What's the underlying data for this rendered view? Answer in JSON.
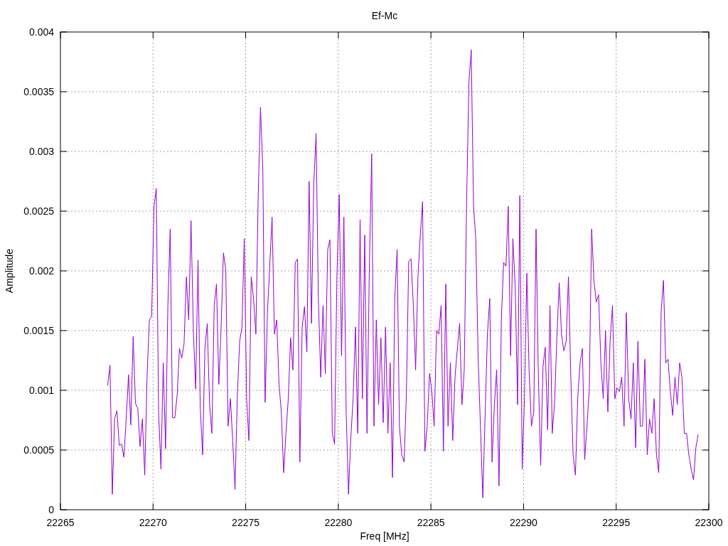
{
  "chart_data": {
    "type": "line",
    "grid": true,
    "title": "Ef-Mc",
    "xlabel": "Freq [MHz]",
    "ylabel": "Amplitude",
    "xlim": [
      22265,
      22300
    ],
    "ylim": [
      0,
      0.004
    ],
    "xticks": [
      22265,
      22270,
      22275,
      22280,
      22285,
      22290,
      22295,
      22300
    ],
    "yticks": [
      {
        "value": 0,
        "label": "0"
      },
      {
        "value": 0.0005,
        "label": "0.0005"
      },
      {
        "value": 0.001,
        "label": "0.001"
      },
      {
        "value": 0.0015,
        "label": "0.0015"
      },
      {
        "value": 0.002,
        "label": "0.002"
      },
      {
        "value": 0.0025,
        "label": "0.0025"
      },
      {
        "value": 0.003,
        "label": "0.003"
      },
      {
        "value": 0.0035,
        "label": "0.0035"
      },
      {
        "value": 0.004,
        "label": "0.004"
      }
    ],
    "x": [
      22267.55,
      22267.675,
      22267.8,
      22267.925,
      22268.05,
      22268.175,
      22268.3,
      22268.425,
      22268.55,
      22268.675,
      22268.8,
      22268.925,
      22269.05,
      22269.175,
      22269.3,
      22269.425,
      22269.55,
      22269.675,
      22269.8,
      22269.925,
      22270.05,
      22270.175,
      22270.3,
      22270.425,
      22270.55,
      22270.675,
      22270.8,
      22270.925,
      22271.05,
      22271.175,
      22271.3,
      22271.425,
      22271.55,
      22271.675,
      22271.8,
      22271.925,
      22272.05,
      22272.175,
      22272.3,
      22272.425,
      22272.55,
      22272.675,
      22272.8,
      22272.925,
      22273.05,
      22273.175,
      22273.3,
      22273.425,
      22273.55,
      22273.675,
      22273.8,
      22273.925,
      22274.05,
      22274.175,
      22274.3,
      22274.425,
      22274.55,
      22274.675,
      22274.8,
      22274.925,
      22275.05,
      22275.175,
      22275.3,
      22275.425,
      22275.55,
      22275.675,
      22275.8,
      22275.925,
      22276.05,
      22276.175,
      22276.3,
      22276.425,
      22276.55,
      22276.675,
      22276.8,
      22276.925,
      22277.05,
      22277.175,
      22277.3,
      22277.425,
      22277.55,
      22277.675,
      22277.8,
      22277.925,
      22278.05,
      22278.175,
      22278.3,
      22278.425,
      22278.55,
      22278.675,
      22278.8,
      22278.925,
      22279.05,
      22279.175,
      22279.3,
      22279.425,
      22279.55,
      22279.675,
      22279.8,
      22279.925,
      22280.05,
      22280.175,
      22280.3,
      22280.425,
      22280.55,
      22280.675,
      22280.8,
      22280.925,
      22281.05,
      22281.175,
      22281.3,
      22281.425,
      22281.55,
      22281.675,
      22281.8,
      22281.925,
      22282.05,
      22282.175,
      22282.3,
      22282.425,
      22282.55,
      22282.675,
      22282.8,
      22282.925,
      22283.05,
      22283.175,
      22283.3,
      22283.425,
      22283.55,
      22283.675,
      22283.8,
      22283.925,
      22284.05,
      22284.175,
      22284.3,
      22284.425,
      22284.55,
      22284.675,
      22284.8,
      22284.925,
      22285.05,
      22285.175,
      22285.3,
      22285.425,
      22285.55,
      22285.675,
      22285.8,
      22285.925,
      22286.05,
      22286.175,
      22286.3,
      22286.425,
      22286.55,
      22286.675,
      22286.8,
      22286.925,
      22287.05,
      22287.175,
      22287.3,
      22287.425,
      22287.55,
      22287.675,
      22287.8,
      22287.925,
      22288.05,
      22288.175,
      22288.3,
      22288.425,
      22288.55,
      22288.675,
      22288.8,
      22288.925,
      22289.05,
      22289.175,
      22289.3,
      22289.425,
      22289.55,
      22289.675,
      22289.8,
      22289.925,
      22290.05,
      22290.175,
      22290.3,
      22290.425,
      22290.55,
      22290.675,
      22290.8,
      22290.925,
      22291.05,
      22291.175,
      22291.3,
      22291.425,
      22291.55,
      22291.675,
      22291.8,
      22291.925,
      22292.05,
      22292.175,
      22292.3,
      22292.425,
      22292.55,
      22292.675,
      22292.8,
      22292.925,
      22293.05,
      22293.175,
      22293.3,
      22293.425,
      22293.55,
      22293.675,
      22293.8,
      22293.925,
      22294.05,
      22294.175,
      22294.3,
      22294.425,
      22294.55,
      22294.675,
      22294.8,
      22294.925,
      22295.05,
      22295.175,
      22295.3,
      22295.425,
      22295.55,
      22295.675,
      22295.8,
      22295.925,
      22296.05,
      22296.175,
      22296.3,
      22296.425,
      22296.55,
      22296.675,
      22296.8,
      22296.925,
      22297.05,
      22297.175,
      22297.3,
      22297.425,
      22297.55,
      22297.675,
      22297.8,
      22297.925,
      22298.05,
      22298.175,
      22298.3,
      22298.425,
      22298.55,
      22298.675,
      22298.8,
      22298.925,
      22299.05,
      22299.175,
      22299.3,
      22299.425
    ],
    "series": [
      {
        "color": "#9400d3",
        "values": [
          0.00104,
          0.00121,
          0.00013,
          0.00076,
          0.00083,
          0.00054,
          0.00055,
          0.00044,
          0.00076,
          0.00113,
          0.00071,
          0.00145,
          0.00089,
          0.00085,
          0.00053,
          0.00076,
          0.00029,
          0.00111,
          0.00159,
          0.00162,
          0.00254,
          0.00269,
          0.00082,
          0.00034,
          0.00123,
          0.00051,
          0.0017,
          0.00235,
          0.00077,
          0.00077,
          0.00096,
          0.00135,
          0.00127,
          0.00139,
          0.00195,
          0.00159,
          0.00242,
          0.0015,
          0.00101,
          0.00209,
          0.00085,
          0.00046,
          0.00135,
          0.00156,
          0.00088,
          0.00064,
          0.00171,
          0.00189,
          0.00105,
          0.00153,
          0.00215,
          0.00201,
          0.0007,
          0.00093,
          0.00058,
          0.00017,
          0.00095,
          0.00141,
          0.00153,
          0.00227,
          0.00093,
          0.00058,
          0.00195,
          0.00177,
          0.00147,
          0.00263,
          0.00337,
          0.00284,
          0.0009,
          0.00165,
          0.00204,
          0.00245,
          0.00147,
          0.00159,
          0.00105,
          0.00082,
          0.00031,
          0.00064,
          0.00093,
          0.00144,
          0.00117,
          0.00207,
          0.0021,
          0.0004,
          0.00153,
          0.0017,
          0.00132,
          0.00275,
          0.00156,
          0.00272,
          0.00315,
          0.00177,
          0.00111,
          0.00171,
          0.00114,
          0.00218,
          0.00226,
          0.00064,
          0.00055,
          0.00195,
          0.00264,
          0.00129,
          0.00245,
          0.00082,
          0.00013,
          0.0006,
          0.00093,
          0.00153,
          0.00064,
          0.00243,
          0.00093,
          0.0023,
          0.00064,
          0.00201,
          0.00298,
          0.0007,
          0.00159,
          0.00088,
          0.00144,
          0.00073,
          0.00153,
          0.00064,
          0.00123,
          0.00027,
          0.00177,
          0.00218,
          0.0007,
          0.00046,
          0.0004,
          0.00096,
          0.00208,
          0.0021,
          0.00171,
          0.00117,
          0.00195,
          0.0023,
          0.00258,
          0.00049,
          0.0007,
          0.00114,
          0.00099,
          0.0007,
          0.0015,
          0.00147,
          0.00171,
          0.00049,
          0.00189,
          0.0007,
          0.00123,
          0.00058,
          0.00111,
          0.00135,
          0.00156,
          0.00088,
          0.00117,
          0.00257,
          0.00358,
          0.00385,
          0.00254,
          0.00226,
          0.00126,
          0.0007,
          0.0001,
          0.0008,
          0.00147,
          0.00177,
          0.0004,
          0.00088,
          0.00117,
          0.0002,
          0.00159,
          0.00207,
          0.00204,
          0.00254,
          0.00129,
          0.00227,
          0.00187,
          0.00088,
          0.00263,
          0.00034,
          0.00093,
          0.00198,
          0.00117,
          0.0007,
          0.00082,
          0.00235,
          0.00111,
          0.00037,
          0.0012,
          0.00136,
          0.00067,
          0.00171,
          0.00064,
          0.0009,
          0.00145,
          0.0019,
          0.00147,
          0.00133,
          0.00141,
          0.00195,
          0.00111,
          0.00046,
          0.00029,
          0.00093,
          0.00123,
          0.00135,
          0.00042,
          0.0007,
          0.00102,
          0.00235,
          0.00192,
          0.00174,
          0.0018,
          0.00123,
          0.00093,
          0.0015,
          0.00082,
          0.00142,
          0.00171,
          0.00093,
          0.00102,
          0.00099,
          0.00111,
          0.0007,
          0.00165,
          0.00093,
          0.00076,
          0.00123,
          0.00052,
          0.00141,
          0.0007,
          0.0007,
          0.00126,
          0.00046,
          0.00076,
          0.00064,
          0.00093,
          0.00046,
          0.00031,
          0.00165,
          0.00192,
          0.00123,
          0.00126,
          0.00099,
          0.00079,
          0.00111,
          0.00088,
          0.00123,
          0.00111,
          0.00064,
          0.00064,
          0.00046,
          0.00034,
          0.00025,
          0.00052,
          0.00063
        ]
      }
    ]
  }
}
